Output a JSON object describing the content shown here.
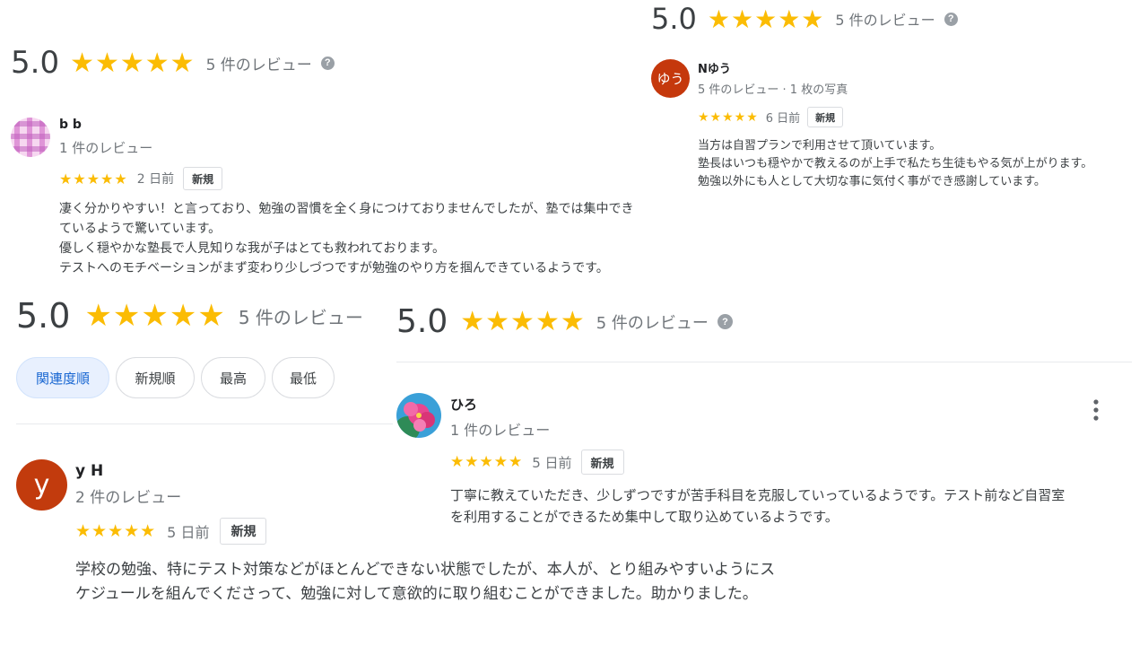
{
  "stars": "★★★★★",
  "colors": {
    "star": "#fbbc04",
    "accent": "#1967d2",
    "avatar_n": "#c5380c",
    "avatar_y": "#c23b0d"
  },
  "summary": {
    "score": "5.0",
    "count": "5 件のレビュー",
    "help": "?"
  },
  "badge_new": "新規",
  "review_bb": {
    "name": "b b",
    "sub": "1 件のレビュー",
    "ago": "2 日前",
    "lines": [
      "凄く分かりやすい！と言っており、勉強の習慣を全く身につけておりませんでしたが、塾では集中でき",
      "ているようで驚いています。",
      "優しく穏やかな塾長で人見知りな我が子はとても救われております。",
      "テストへのモチベーションがまず変わり少しづつですが勉強のやり方を掴んできているようです。"
    ]
  },
  "review_n": {
    "name": "Nゆう",
    "avatar_letter": "ゆう",
    "sub": "5 件のレビュー · 1 枚の写真",
    "ago": "6 日前",
    "lines": [
      "当方は自習プランで利用させて頂いています。",
      "塾長はいつも穏やかで教えるのが上手で私たち生徒もやる気が上がります。",
      "勉強以外にも人として大切な事に気付く事ができ感謝しています。"
    ]
  },
  "sort_chips": [
    "関連度順",
    "新規順",
    "最高",
    "最低"
  ],
  "review_y": {
    "name": "y H",
    "avatar_letter": "y",
    "sub": "2 件のレビュー",
    "ago": "5 日前",
    "lines": [
      "学校の勉強、特にテスト対策などがほとんどできない状態でしたが、本人が、とり組みやすいようにス",
      "ケジュールを組んでくださって、勉強に対して意欲的に取り組むことができました。助かりました。"
    ]
  },
  "review_h": {
    "name": "ひろ",
    "sub": "1 件のレビュー",
    "ago": "5 日前",
    "lines": [
      "丁寧に教えていただき、少しずつですが苦手科目を克服していっているようです。テスト前など自習室",
      "を利用することができるため集中して取り込めているようです。"
    ],
    "more_icon": "more-vert-icon"
  }
}
